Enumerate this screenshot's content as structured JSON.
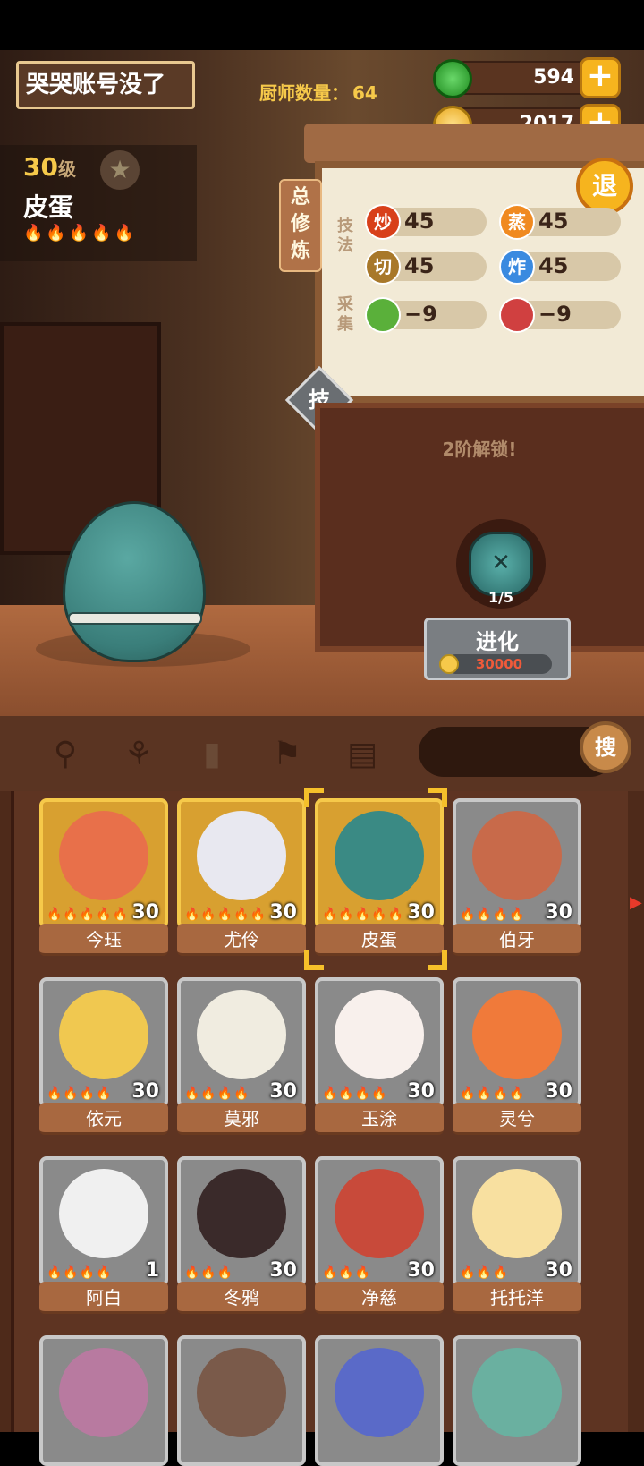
{
  "header": {
    "account_name": "哭哭账号没了",
    "chef_count_label": "厨师数量：",
    "chef_count": "64",
    "resources": [
      {
        "name": "jade",
        "value": "594",
        "color": "#2ea82e"
      },
      {
        "name": "coin",
        "value": "2017",
        "color": "#f6c94a"
      }
    ],
    "plus_symbol": "+"
  },
  "chef": {
    "level": "30",
    "level_unit": "级",
    "name": "皮蛋",
    "flames": "🔥🔥🔥🔥🔥",
    "star_icon": "★"
  },
  "panel": {
    "side_tab": "总修炼",
    "exit_label": "退",
    "skills_label": "技法",
    "gather_label": "采集",
    "skills": [
      {
        "icon_text": "炒",
        "value": "45",
        "color": "#d8401a"
      },
      {
        "icon_text": "蒸",
        "value": "45",
        "color": "#f08a20"
      },
      {
        "icon_text": "切",
        "value": "45",
        "color": "#a8782a"
      },
      {
        "icon_text": "炸",
        "value": "45",
        "color": "#3a8ae0"
      },
      {
        "icon_text": "",
        "value": "−9",
        "color": "#5ab03a"
      },
      {
        "icon_text": "",
        "value": "−9",
        "color": "#d04040"
      }
    ],
    "tech_icon": "技",
    "unlock_text": "2阶解锁!",
    "evolve_progress": "1/5",
    "evolve_label": "进化",
    "evolve_cost": "30000"
  },
  "toolbar": {
    "tools": [
      "pot-icon",
      "spatula-icon",
      "jar-icon",
      "location-pin-icon",
      "map-icon"
    ],
    "search_label": "搜"
  },
  "roster": [
    {
      "name": "今珏",
      "level": "30",
      "flames": "🔥🔥🔥🔥🔥",
      "tier": "gold",
      "color": "#e8704a"
    },
    {
      "name": "尤伶",
      "level": "30",
      "flames": "🔥🔥🔥🔥🔥",
      "tier": "gold",
      "color": "#e8e8f0"
    },
    {
      "name": "皮蛋",
      "level": "30",
      "flames": "🔥🔥🔥🔥🔥",
      "tier": "gold",
      "color": "#3a8a84"
    },
    {
      "name": "伯牙",
      "level": "30",
      "flames": "🔥🔥🔥🔥",
      "tier": "grey",
      "color": "#c86a4a"
    },
    {
      "name": "依元",
      "level": "30",
      "flames": "🔥🔥🔥🔥",
      "tier": "grey",
      "color": "#f0c850"
    },
    {
      "name": "莫邪",
      "level": "30",
      "flames": "🔥🔥🔥🔥",
      "tier": "grey",
      "color": "#f0ece0"
    },
    {
      "name": "玉涂",
      "level": "30",
      "flames": "🔥🔥🔥🔥",
      "tier": "grey",
      "color": "#f8f0ec"
    },
    {
      "name": "灵兮",
      "level": "30",
      "flames": "🔥🔥🔥🔥",
      "tier": "grey",
      "color": "#f07a3a"
    },
    {
      "name": "阿白",
      "level": "1",
      "flames": "🔥🔥🔥🔥",
      "tier": "grey",
      "color": "#f0f0f0"
    },
    {
      "name": "冬鸦",
      "level": "30",
      "flames": "🔥🔥🔥",
      "tier": "grey",
      "color": "#3a2a2a"
    },
    {
      "name": "净慈",
      "level": "30",
      "flames": "🔥🔥🔥",
      "tier": "grey",
      "color": "#c84a3a"
    },
    {
      "name": "托托洋",
      "level": "30",
      "flames": "🔥🔥🔥",
      "tier": "grey",
      "color": "#f8e0a0"
    },
    {
      "name": "",
      "level": "",
      "flames": "",
      "tier": "grey",
      "color": "#b87aa0"
    },
    {
      "name": "",
      "level": "",
      "flames": "",
      "tier": "grey",
      "color": "#7a5a4a"
    },
    {
      "name": "",
      "level": "",
      "flames": "",
      "tier": "grey",
      "color": "#5a6ac8"
    },
    {
      "name": "",
      "level": "",
      "flames": "",
      "tier": "grey",
      "color": "#6ab0a0"
    }
  ]
}
